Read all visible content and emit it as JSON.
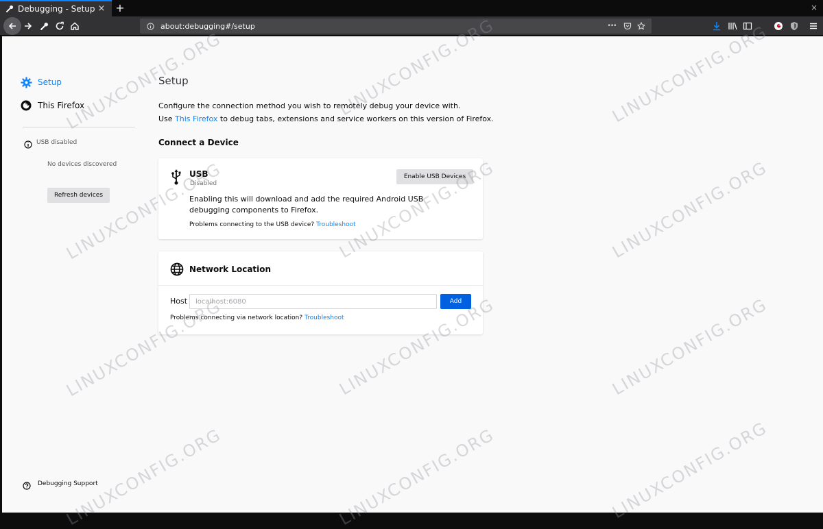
{
  "browser": {
    "tab_title": "Debugging - Setup",
    "tab_close": "×",
    "new_tab": "+",
    "window_close": "×",
    "url": "about:debugging#/setup",
    "url_more": "•••",
    "accent": "#0a84ff"
  },
  "sidebar": {
    "items": [
      {
        "label": "Setup",
        "icon": "gear-icon",
        "selected": true
      },
      {
        "label": "This Firefox",
        "icon": "firefox-icon",
        "selected": false
      }
    ],
    "usb_status": "USB disabled",
    "no_devices": "No devices discovered",
    "refresh_label": "Refresh devices",
    "support_label": "Debugging Support"
  },
  "main": {
    "title": "Setup",
    "intro_line1": "Configure the connection method you wish to remotely debug your device with.",
    "intro_line2_prefix": "Use ",
    "intro_line2_link": "This Firefox",
    "intro_line2_suffix": " to debug tabs, extensions and service workers on this version of Firefox.",
    "connect_title": "Connect a Device",
    "usb": {
      "title": "USB",
      "status": "Disabled",
      "enable_label": "Enable USB Devices",
      "description": "Enabling this will download and add the required Android USB debugging components to Firefox.",
      "problem_text": "Problems connecting to the USB device?",
      "troubleshoot": "Troubleshoot"
    },
    "network": {
      "title": "Network Location",
      "host_label": "Host",
      "host_placeholder": "localhost:6080",
      "add_label": "Add",
      "problem_text": "Problems connecting via network location?",
      "troubleshoot": "Troubleshoot"
    }
  },
  "watermark": "LINUXCONFIG.ORG"
}
